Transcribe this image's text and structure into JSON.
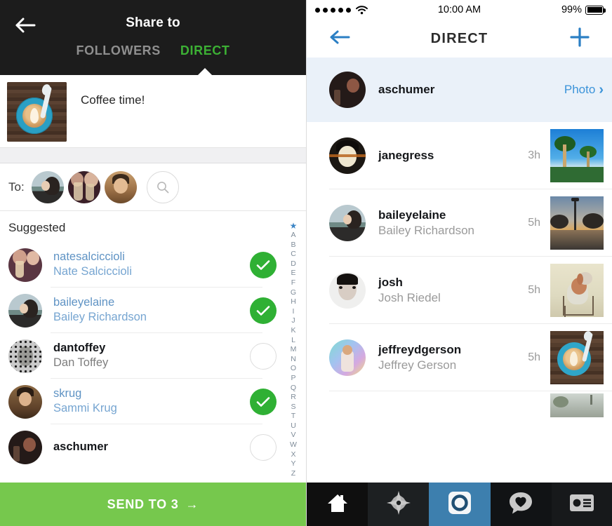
{
  "share_panel": {
    "back_icon": "back-arrow-icon",
    "title": "Share to",
    "tabs": [
      {
        "label": "FOLLOWERS",
        "active": false
      },
      {
        "label": "DIRECT",
        "active": true
      }
    ],
    "accent_green": "#3cb034",
    "post": {
      "caption": "Coffee time!",
      "thumbnail": "coffee-cup-photo"
    },
    "to_row": {
      "label": "To:",
      "selected_avatars": [
        "baileyelaine-avatar",
        "natesalciccioli-avatar",
        "skrug-avatar"
      ],
      "search_icon": "search-icon"
    },
    "suggested": {
      "header": "Suggested",
      "people": [
        {
          "username": "natesalciccioli",
          "fullname": "Nate Salciccioli",
          "selected": true,
          "avatar": "natesalciccioli-avatar"
        },
        {
          "username": "baileyelaine",
          "fullname": "Bailey Richardson",
          "selected": true,
          "avatar": "baileyelaine-avatar"
        },
        {
          "username": "dantoffey",
          "fullname": "Dan Toffey",
          "selected": false,
          "avatar": "dantoffey-avatar"
        },
        {
          "username": "skrug",
          "fullname": "Sammi Krug",
          "selected": true,
          "avatar": "skrug-avatar"
        },
        {
          "username": "aschumer",
          "fullname": "",
          "selected": false,
          "avatar": "aschumer-avatar"
        }
      ]
    },
    "alpha_index": [
      "★",
      "A",
      "B",
      "C",
      "D",
      "E",
      "F",
      "G",
      "H",
      "I",
      "J",
      "K",
      "L",
      "M",
      "N",
      "O",
      "P",
      "Q",
      "R",
      "S",
      "T",
      "U",
      "V",
      "W",
      "X",
      "Y",
      "Z"
    ],
    "send_button": {
      "label": "SEND TO 3",
      "arrow": "→",
      "color": "#76c84d"
    }
  },
  "direct_panel": {
    "status_bar": {
      "signal": "•••••",
      "wifi_icon": "wifi-icon",
      "time": "10:00 AM",
      "battery_percent": "99%",
      "battery_icon": "battery-full-icon"
    },
    "header": {
      "back_icon": "back-arrow-icon",
      "title": "DIRECT",
      "add_icon": "plus-icon",
      "accent_blue": "#2b7fc4"
    },
    "threads": [
      {
        "username": "aschumer",
        "fullname": "",
        "time": "",
        "action": "Photo",
        "chevron": "›",
        "highlight": true,
        "avatar": "aschumer-avatar",
        "thumbnail": ""
      },
      {
        "username": "janegress",
        "fullname": "",
        "time": "3h",
        "action": "",
        "chevron": "",
        "highlight": false,
        "avatar": "janegress-avatar",
        "thumbnail": "palm-trees-photo"
      },
      {
        "username": "baileyelaine",
        "fullname": "Bailey Richardson",
        "time": "5h",
        "action": "",
        "chevron": "",
        "highlight": false,
        "avatar": "baileyelaine-avatar",
        "thumbnail": "sunset-street-photo"
      },
      {
        "username": "josh",
        "fullname": "Josh Riedel",
        "time": "5h",
        "action": "",
        "chevron": "",
        "highlight": false,
        "avatar": "josh-avatar",
        "thumbnail": "dog-on-chair-photo"
      },
      {
        "username": "jeffreydgerson",
        "fullname": "Jeffrey Gerson",
        "time": "5h",
        "action": "",
        "chevron": "",
        "highlight": false,
        "avatar": "jeffreydgerson-avatar",
        "thumbnail": "coffee-cup-photo"
      }
    ],
    "tab_bar": {
      "active_color": "#3d7fae",
      "items": [
        {
          "icon": "home-icon",
          "active": false
        },
        {
          "icon": "explore-star-icon",
          "active": false
        },
        {
          "icon": "camera-icon",
          "active": true
        },
        {
          "icon": "activity-heart-icon",
          "active": false
        },
        {
          "icon": "profile-card-icon",
          "active": false
        }
      ]
    }
  }
}
